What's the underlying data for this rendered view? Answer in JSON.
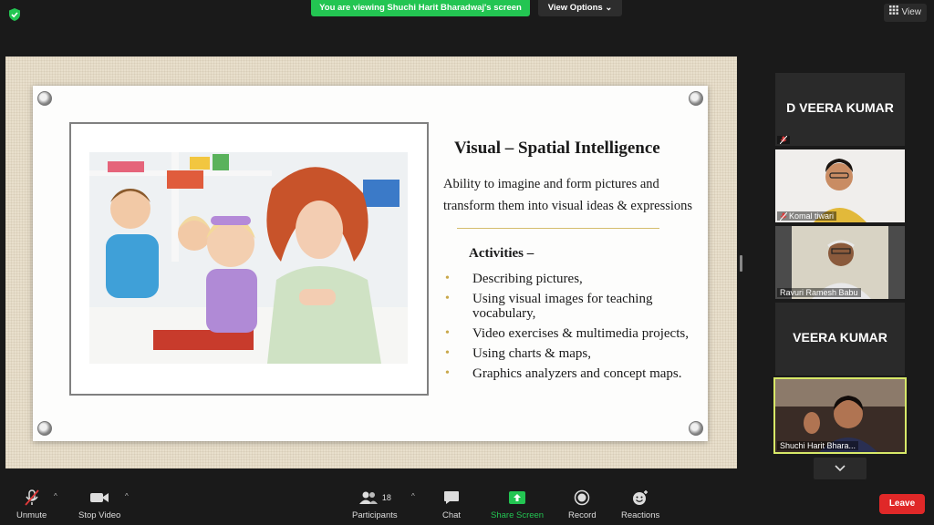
{
  "top": {
    "banner": "You are viewing Shuchi Harit Bharadwaj's screen",
    "view_options": "View Options",
    "view": "View"
  },
  "slide": {
    "title": "Visual – Spatial Intelligence",
    "description": "Ability to imagine and form pictures and transform them into visual ideas & expressions",
    "activities_heading": "Activities –",
    "bullets": [
      "Describing pictures,",
      "Using visual images for teaching vocabulary,",
      "Video exercises & multimedia projects,",
      "Using charts & maps,",
      "Graphics analyzers and concept maps."
    ]
  },
  "participants": [
    {
      "name": "D VEERA KUMAR",
      "label": "",
      "type": "name"
    },
    {
      "name": "",
      "label": "Komal tiwari",
      "type": "video"
    },
    {
      "name": "",
      "label": "Ravuri Ramesh Babu",
      "type": "video"
    },
    {
      "name": "VEERA KUMAR",
      "label": "",
      "type": "name"
    },
    {
      "name": "",
      "label": "Shuchi Harit Bhara...",
      "type": "video"
    }
  ],
  "toolbar": {
    "unmute": "Unmute",
    "stop_video": "Stop Video",
    "participants": "Participants",
    "participant_count": "18",
    "chat": "Chat",
    "share_screen": "Share Screen",
    "record": "Record",
    "reactions": "Reactions",
    "leave": "Leave"
  },
  "colors": {
    "share_green": "#23c552",
    "leave_red": "#e02828",
    "active_speaker": "#d7e868"
  }
}
